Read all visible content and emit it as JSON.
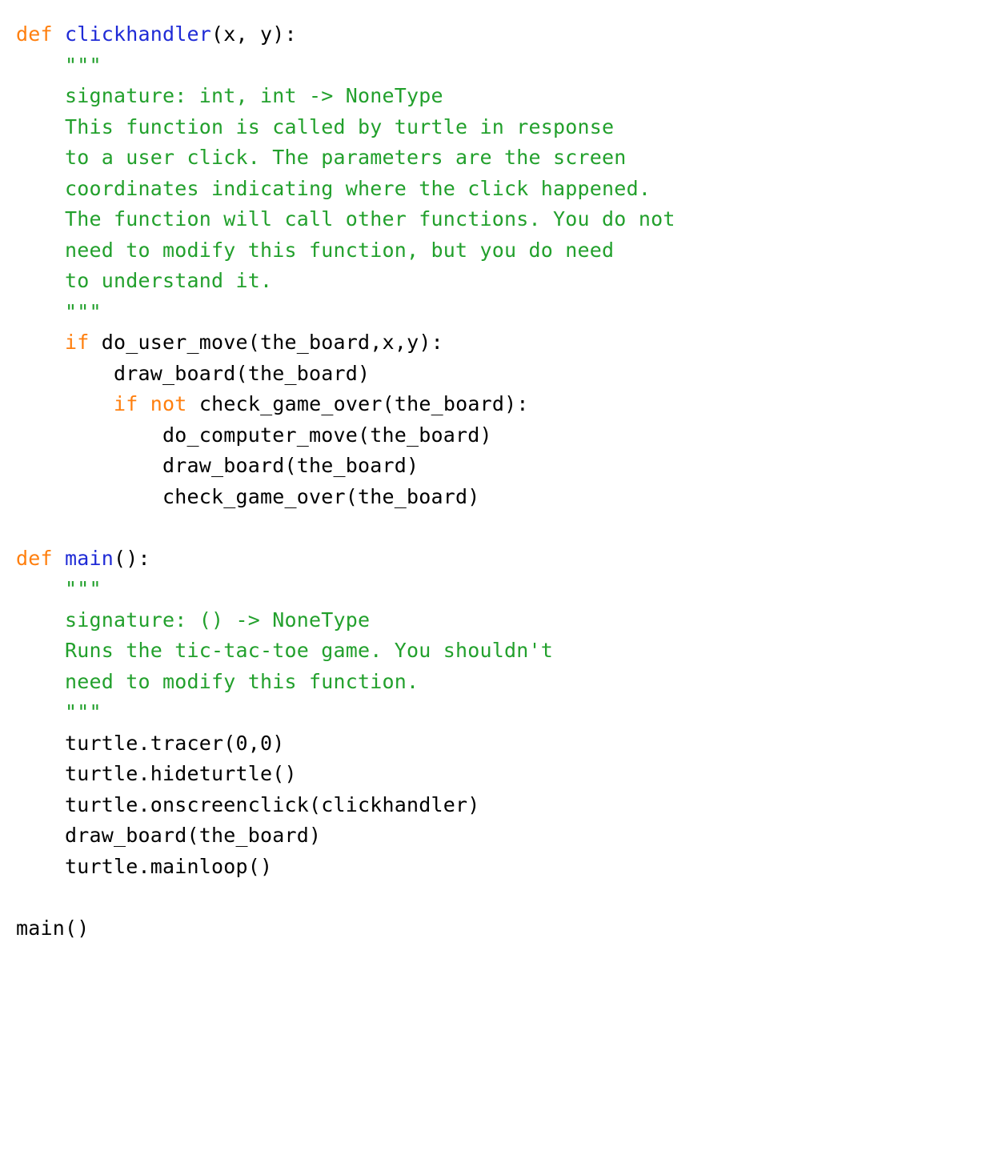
{
  "tokens": [
    {
      "cls": "tok-kw",
      "t": "def"
    },
    {
      "cls": "tok-txt",
      "t": " "
    },
    {
      "cls": "tok-fn",
      "t": "clickhandler"
    },
    {
      "cls": "tok-txt",
      "t": "(x, y):"
    },
    {
      "cls": "nl",
      "t": "\n"
    },
    {
      "cls": "tok-doc",
      "t": "    \"\"\""
    },
    {
      "cls": "nl",
      "t": "\n"
    },
    {
      "cls": "tok-doc",
      "t": "    signature: int, int -> NoneType"
    },
    {
      "cls": "nl",
      "t": "\n"
    },
    {
      "cls": "tok-doc",
      "t": "    This function is called by turtle in response"
    },
    {
      "cls": "nl",
      "t": "\n"
    },
    {
      "cls": "tok-doc",
      "t": "    to a user click. The parameters are the screen"
    },
    {
      "cls": "nl",
      "t": "\n"
    },
    {
      "cls": "tok-doc",
      "t": "    coordinates indicating where the click happened."
    },
    {
      "cls": "nl",
      "t": "\n"
    },
    {
      "cls": "tok-doc",
      "t": "    The function will call other functions. You do not"
    },
    {
      "cls": "nl",
      "t": "\n"
    },
    {
      "cls": "tok-doc",
      "t": "    need to modify this function, but you do need"
    },
    {
      "cls": "nl",
      "t": "\n"
    },
    {
      "cls": "tok-doc",
      "t": "    to understand it."
    },
    {
      "cls": "nl",
      "t": "\n"
    },
    {
      "cls": "tok-doc",
      "t": "    \"\"\""
    },
    {
      "cls": "nl",
      "t": "\n"
    },
    {
      "cls": "tok-txt",
      "t": "    "
    },
    {
      "cls": "tok-kw",
      "t": "if"
    },
    {
      "cls": "tok-txt",
      "t": " do_user_move(the_board,x,y):"
    },
    {
      "cls": "nl",
      "t": "\n"
    },
    {
      "cls": "tok-txt",
      "t": "        draw_board(the_board)"
    },
    {
      "cls": "nl",
      "t": "\n"
    },
    {
      "cls": "tok-txt",
      "t": "        "
    },
    {
      "cls": "tok-kw",
      "t": "if"
    },
    {
      "cls": "tok-txt",
      "t": " "
    },
    {
      "cls": "tok-kw",
      "t": "not"
    },
    {
      "cls": "tok-txt",
      "t": " check_game_over(the_board):"
    },
    {
      "cls": "nl",
      "t": "\n"
    },
    {
      "cls": "tok-txt",
      "t": "            do_computer_move(the_board)"
    },
    {
      "cls": "nl",
      "t": "\n"
    },
    {
      "cls": "tok-txt",
      "t": "            draw_board(the_board)"
    },
    {
      "cls": "nl",
      "t": "\n"
    },
    {
      "cls": "tok-txt",
      "t": "            check_game_over(the_board)"
    },
    {
      "cls": "nl",
      "t": "\n"
    },
    {
      "cls": "nl",
      "t": "\n"
    },
    {
      "cls": "tok-kw",
      "t": "def"
    },
    {
      "cls": "tok-txt",
      "t": " "
    },
    {
      "cls": "tok-fn",
      "t": "main"
    },
    {
      "cls": "tok-txt",
      "t": "():"
    },
    {
      "cls": "nl",
      "t": "\n"
    },
    {
      "cls": "tok-doc",
      "t": "    \"\"\""
    },
    {
      "cls": "nl",
      "t": "\n"
    },
    {
      "cls": "tok-doc",
      "t": "    signature: () -> NoneType"
    },
    {
      "cls": "nl",
      "t": "\n"
    },
    {
      "cls": "tok-doc",
      "t": "    Runs the tic-tac-toe game. You shouldn't"
    },
    {
      "cls": "nl",
      "t": "\n"
    },
    {
      "cls": "tok-doc",
      "t": "    need to modify this function."
    },
    {
      "cls": "nl",
      "t": "\n"
    },
    {
      "cls": "tok-doc",
      "t": "    \"\"\""
    },
    {
      "cls": "nl",
      "t": "\n"
    },
    {
      "cls": "tok-txt",
      "t": "    turtle.tracer(0,0)"
    },
    {
      "cls": "nl",
      "t": "\n"
    },
    {
      "cls": "tok-txt",
      "t": "    turtle.hideturtle()"
    },
    {
      "cls": "nl",
      "t": "\n"
    },
    {
      "cls": "tok-txt",
      "t": "    turtle.onscreenclick(clickhandler)"
    },
    {
      "cls": "nl",
      "t": "\n"
    },
    {
      "cls": "tok-txt",
      "t": "    draw_board(the_board)"
    },
    {
      "cls": "nl",
      "t": "\n"
    },
    {
      "cls": "tok-txt",
      "t": "    turtle.mainloop()"
    },
    {
      "cls": "nl",
      "t": "\n"
    },
    {
      "cls": "nl",
      "t": "\n"
    },
    {
      "cls": "tok-txt",
      "t": "main()"
    }
  ]
}
